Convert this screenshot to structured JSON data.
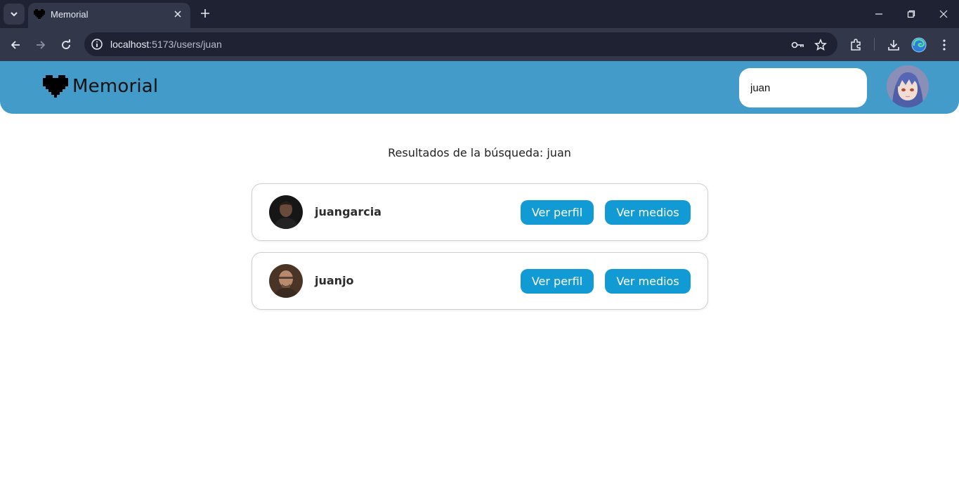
{
  "browser": {
    "tab_title": "Memorial",
    "url_host": "localhost",
    "url_path": ":5173/users/juan"
  },
  "header": {
    "logo_text": "Memorial",
    "search_value": "juan"
  },
  "results": {
    "heading": "Resultados de la búsqueda: juan",
    "users": [
      {
        "username": "juangarcia",
        "profile_label": "Ver perfil",
        "media_label": "Ver medios"
      },
      {
        "username": "juanjo",
        "profile_label": "Ver perfil",
        "media_label": "Ver medios"
      }
    ]
  },
  "colors": {
    "header_bg": "#429bc8",
    "button_bg": "#129ad5",
    "browser_frame": "#1f2233",
    "browser_toolbar": "#33374a"
  },
  "icons": [
    "tab-search-icon",
    "heart-favicon-icon",
    "close-icon",
    "plus-icon",
    "minimize-icon",
    "restore-icon",
    "back-icon",
    "forward-icon",
    "reload-icon",
    "site-info-icon",
    "key-icon",
    "star-icon",
    "extensions-icon",
    "download-icon",
    "edge-profile-icon",
    "more-icon",
    "heart-logo-icon"
  ]
}
